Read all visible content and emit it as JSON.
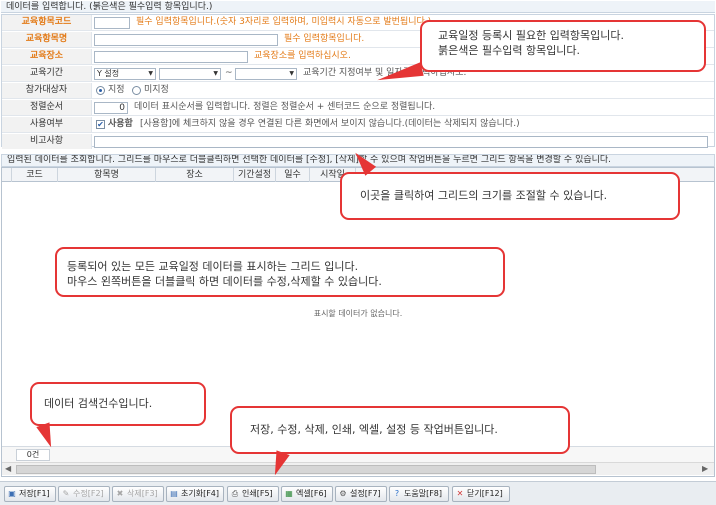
{
  "form": {
    "title": "데이터를 입력합니다. (붉은색은 필수입력 항목입니다.)",
    "rows": {
      "code": {
        "label": "교육항목코드",
        "hint": "필수 입력항목입니다.(숫자 3자리로 입력하며, 미입력시 자동으로 발번됩니다.)"
      },
      "name": {
        "label": "교육항목명",
        "hint": "필수 입력항목입니다."
      },
      "place": {
        "label": "교육장소",
        "hint": "교육장소를 입력하십시오."
      },
      "period": {
        "label": "교육기간",
        "select_value": "Y 설정",
        "tilde": "~",
        "hint": "교육기간 지정여부 및 일자를 입력하십시오."
      },
      "target": {
        "label": "참가대상자",
        "opt1": "지정",
        "opt2": "미지정"
      },
      "order": {
        "label": "정렬순서",
        "value": "0",
        "hint": "데이터 표시순서를 입력합니다. 정렬은 정렬순서 + 센터코드 순으로 정렬됩니다."
      },
      "use": {
        "label": "사용여부",
        "check_label": "사용함",
        "hint": "[사용함]에 체크하지 않을 경우 연결된 다른 화면에서 보이지 않습니다.(데이터는 삭제되지 않습니다.)"
      },
      "note": {
        "label": "비고사항"
      }
    }
  },
  "grid": {
    "title": "입력된 데이터를 조회합니다. 그리드를 마우스로 더블클릭하면 선택한 데이터를 [수정], [삭제]할 수 있으며 작업버튼을 누르면 그리드 항목을 변경할 수 있습니다.",
    "columns": [
      "코드",
      "항목명",
      "장소",
      "기간설정",
      "일수",
      "시작일"
    ],
    "empty": "표시할 데이터가 없습니다.",
    "count": "0건"
  },
  "toolbar": {
    "save": "저장[F1]",
    "edit": "수정[F2]",
    "delete": "삭제[F3]",
    "reset": "초기화[F4]",
    "print": "인쇄[F5]",
    "excel": "엑셀[F6]",
    "settings": "설정[F7]",
    "help": "도움말[F8]",
    "close": "닫기[F12]"
  },
  "callouts": {
    "required": [
      "교육일정 등록시 필요한 입력항목입니다.",
      "붉은색은 필수입력 항목입니다."
    ],
    "resize": "이곳을 클릭하여 그리드의 크기를 조절할 수 있습니다.",
    "grid": [
      "등록되어 있는 모든 교육일정 데이터를 표시하는 그리드 입니다.",
      "마우스 왼쪽버튼을 더블클릭 하면 데이터를 수정,삭제할 수 있습니다."
    ],
    "count": "데이터 검색건수입니다.",
    "buttons": "저장, 수정, 삭제, 인쇄, 엑셀, 설정 등 작업버튼입니다."
  },
  "colors": {
    "required_label": "#e37b18",
    "callout_border": "#e53535"
  }
}
